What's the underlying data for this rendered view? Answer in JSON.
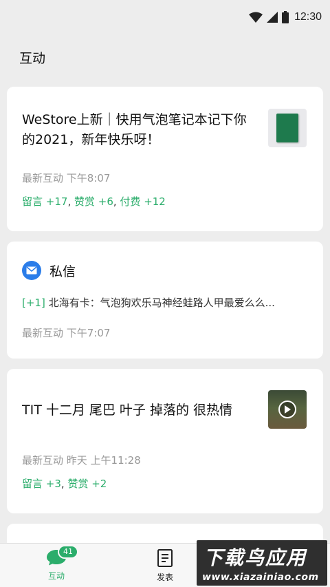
{
  "status_bar": {
    "time": "12:30"
  },
  "page_title": "互动",
  "feed": [
    {
      "title": "WeStore上新｜快用气泡笔记本记下你的2021，新年快乐呀！",
      "meta": "最新互动  下午8:07",
      "stats": [
        "留言 +17",
        "赞赏 +6",
        "付费 +12"
      ],
      "thumbnail": "notebook-thumbnail"
    },
    {
      "type": "message",
      "title": "私信",
      "preview_count": "[+1]",
      "preview_text": "北海有卡：气泡狗欢乐马神经蛙路人甲最爱么么...",
      "meta": "最新互动  下午7:07"
    },
    {
      "title": "TIT 十二月 尾巴 叶子 掉落的 很热情",
      "meta": "最新互动 昨天 上午11:28",
      "stats": [
        "留言 +3",
        "赞赏 +2"
      ],
      "thumbnail": "video-thumbnail"
    }
  ],
  "tabbar": {
    "interact": {
      "label": "互动",
      "badge": "41",
      "icon": "chat-bubble-icon"
    },
    "publish": {
      "label": "发表",
      "icon": "document-icon"
    }
  },
  "watermark": {
    "title": "下载鸟应用",
    "url": "www.xiazainiao.com"
  },
  "colors": {
    "accent": "#2bad6b",
    "dm_icon": "#2b7de9",
    "background": "#ededed"
  }
}
